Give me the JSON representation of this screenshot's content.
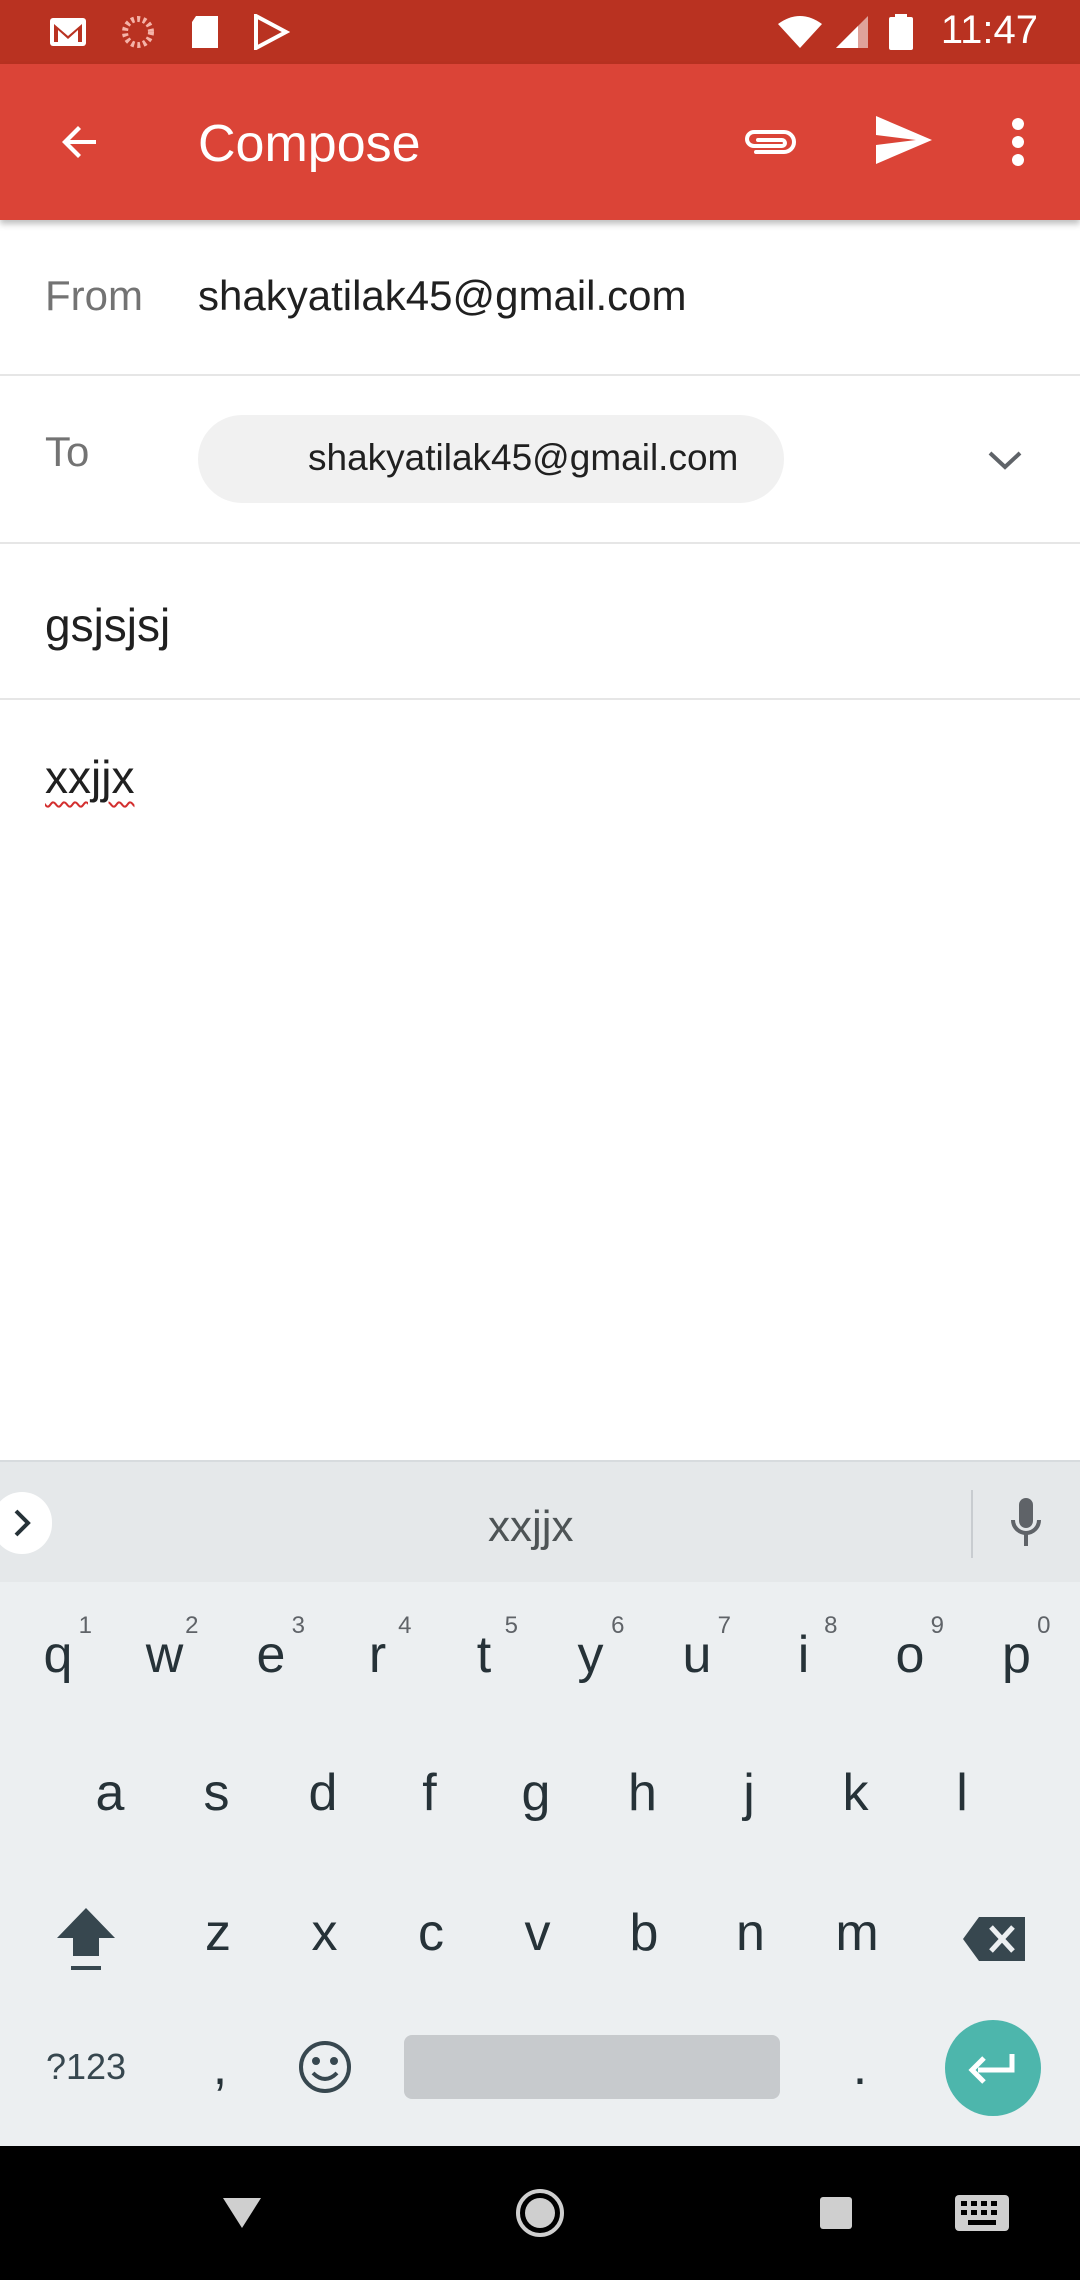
{
  "status_bar": {
    "time": "11:47",
    "icons": [
      "gmail-icon",
      "sync-icon",
      "sd-card-icon",
      "play-store-icon",
      "wifi-icon",
      "cellular-icon",
      "battery-icon"
    ]
  },
  "app_bar": {
    "title": "Compose",
    "back_icon": "arrow-back-icon",
    "attach_icon": "paperclip-icon",
    "send_icon": "send-icon",
    "more_icon": "more-vert-icon",
    "color": "#db4437"
  },
  "compose": {
    "from_label": "From",
    "from_value": "shakyatilak45@gmail.com",
    "to_label": "To",
    "to_chip": "shakyatilak45@gmail.com",
    "subject": "gsjsjsj",
    "body": "xxjjx"
  },
  "keyboard": {
    "suggestion": "xxjjx",
    "row1": [
      {
        "k": "q",
        "n": "1"
      },
      {
        "k": "w",
        "n": "2"
      },
      {
        "k": "e",
        "n": "3"
      },
      {
        "k": "r",
        "n": "4"
      },
      {
        "k": "t",
        "n": "5"
      },
      {
        "k": "y",
        "n": "6"
      },
      {
        "k": "u",
        "n": "7"
      },
      {
        "k": "i",
        "n": "8"
      },
      {
        "k": "o",
        "n": "9"
      },
      {
        "k": "p",
        "n": "0"
      }
    ],
    "row2": [
      "a",
      "s",
      "d",
      "f",
      "g",
      "h",
      "j",
      "k",
      "l"
    ],
    "row3": [
      "z",
      "x",
      "c",
      "v",
      "b",
      "n",
      "m"
    ],
    "symbols_key": "?123",
    "comma_key": ",",
    "period_key": ".",
    "enter_color": "#4db6ac"
  },
  "nav_bar": {
    "icons": [
      "back-triangle-icon",
      "home-circle-icon",
      "recents-square-icon",
      "keyboard-switch-icon"
    ]
  }
}
